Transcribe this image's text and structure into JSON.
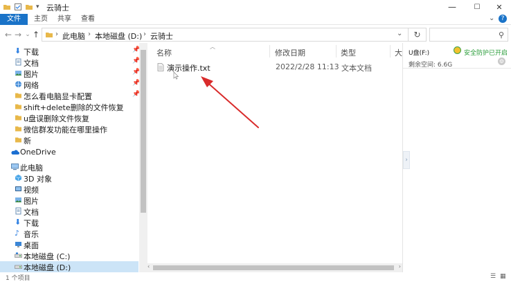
{
  "window": {
    "title": "云骑士",
    "controls": {
      "minimize": "—",
      "maximize": "☐",
      "close": "✕"
    }
  },
  "ribbon": {
    "tabs": [
      {
        "label": "文件",
        "active": true
      },
      {
        "label": "主页",
        "active": false
      },
      {
        "label": "共享",
        "active": false
      },
      {
        "label": "查看",
        "active": false
      }
    ],
    "expand_icon": "chevron-down-icon",
    "help_icon": "help-icon"
  },
  "address": {
    "crumbs": [
      "此电脑",
      "本地磁盘 (D:)",
      "云骑士"
    ],
    "search_placeholder": ""
  },
  "nav": {
    "quick_access": [
      {
        "label": "下载",
        "icon": "download-arrow-icon",
        "pinned": true
      },
      {
        "label": "文档",
        "icon": "document-icon",
        "pinned": true
      },
      {
        "label": "图片",
        "icon": "picture-icon",
        "pinned": true
      },
      {
        "label": "网络",
        "icon": "network-icon",
        "pinned": true
      },
      {
        "label": "怎么看电脑显卡配置",
        "icon": "folder-icon",
        "pinned": true
      },
      {
        "label": "shift+delete删除的文件恢复",
        "icon": "folder-icon",
        "pinned": false
      },
      {
        "label": "u盘误删除文件恢复",
        "icon": "folder-icon",
        "pinned": false
      },
      {
        "label": "微信群发功能在哪里操作",
        "icon": "folder-icon",
        "pinned": false
      },
      {
        "label": "新",
        "icon": "folder-icon",
        "pinned": false
      }
    ],
    "onedrive": {
      "label": "OneDrive",
      "icon": "cloud-icon"
    },
    "this_pc": {
      "label": "此电脑",
      "icon": "computer-icon",
      "items": [
        {
          "label": "3D 对象",
          "icon": "cube-icon"
        },
        {
          "label": "视频",
          "icon": "video-icon"
        },
        {
          "label": "图片",
          "icon": "picture-icon"
        },
        {
          "label": "文档",
          "icon": "document-icon"
        },
        {
          "label": "下载",
          "icon": "download-arrow-icon"
        },
        {
          "label": "音乐",
          "icon": "music-icon"
        },
        {
          "label": "桌面",
          "icon": "desktop-icon"
        },
        {
          "label": "本地磁盘 (C:)",
          "icon": "drive-icon"
        },
        {
          "label": "本地磁盘 (D:)",
          "icon": "drive-icon",
          "selected": true
        }
      ]
    }
  },
  "columns": {
    "name": "名称",
    "modified": "修改日期",
    "type": "类型",
    "size": "大"
  },
  "files": [
    {
      "name": "演示操作.txt",
      "modified": "2022/2/28 11:13",
      "type": "文本文档",
      "icon": "text-file-icon"
    }
  ],
  "details": {
    "drive_label": "U盘(F:)",
    "security_text": "安全防护已开启",
    "free_space": "剩余空间: 6.6G",
    "colors": {
      "security_green": "#2a9d3a"
    }
  },
  "status": {
    "count": "1 个项目"
  },
  "colors": {
    "accent": "#1a73c8",
    "arrow": "#d92b2b",
    "selected": "#cce4f7"
  }
}
